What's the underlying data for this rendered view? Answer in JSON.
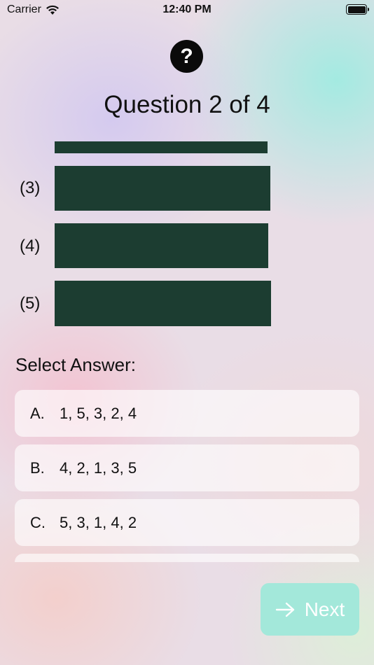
{
  "status_bar": {
    "carrier": "Carrier",
    "time": "12:40 PM"
  },
  "header": {
    "help_symbol": "?",
    "title": "Question 2 of 4"
  },
  "question": {
    "bar_color": "#1c3d31",
    "bars": [
      {
        "label": ""
      },
      {
        "label": "(3)"
      },
      {
        "label": "(4)"
      },
      {
        "label": "(5)"
      }
    ]
  },
  "answers": {
    "heading": "Select Answer:",
    "options": [
      {
        "letter": "A.",
        "text": "1, 5, 3, 2, 4"
      },
      {
        "letter": "B.",
        "text": "4, 2, 1, 3, 5"
      },
      {
        "letter": "C.",
        "text": "5, 3, 1, 4, 2"
      }
    ]
  },
  "footer": {
    "next_label": "Next",
    "next_icon": "arrow-right-icon",
    "accent": "#a3e8da"
  }
}
